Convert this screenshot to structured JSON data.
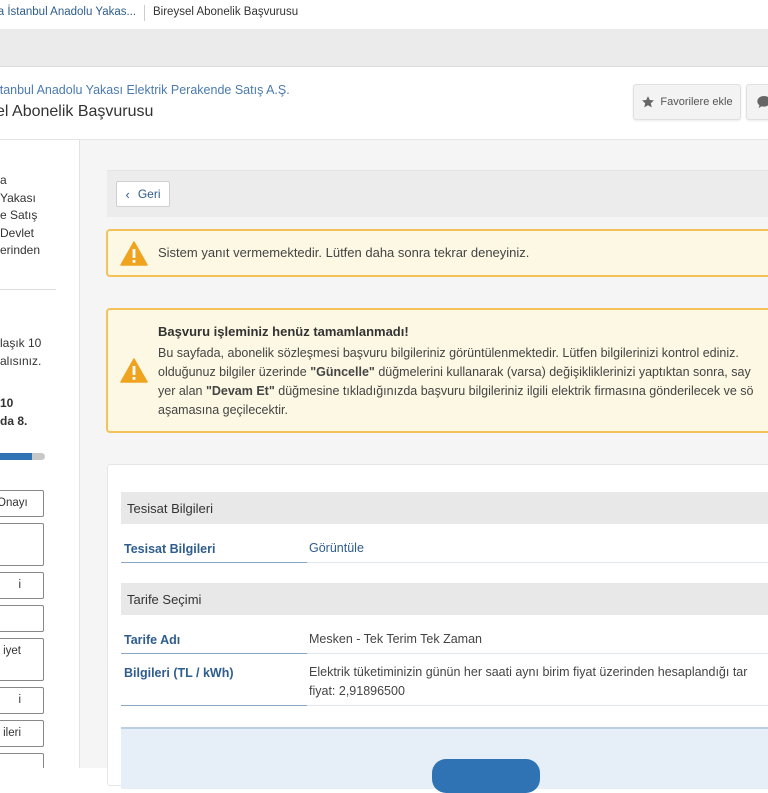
{
  "breadcrumb": {
    "company": "sa İstanbul Anadolu Yakas...",
    "current": "Bireysel Abonelik Başvurusu"
  },
  "header": {
    "org_name": "İstanbul Anadolu Yakası Elektrik Perakende Satış A.Ş.",
    "page_title": "sel Abonelik Başvurusu",
    "favorite_label": "Favorilere ekle"
  },
  "sidebar": {
    "description_lines": [
      "a",
      "Yakası",
      "e Satış",
      "Devlet",
      "erinden"
    ],
    "info_lines": [
      "laşık 10",
      "alısınız."
    ],
    "step_lines": [
      "10",
      "da 8."
    ],
    "progress_percent": 70,
    "steps": [
      "Onayı",
      "",
      "i",
      "",
      "iyet",
      "i",
      "ileri",
      ""
    ]
  },
  "main": {
    "back_label": "Geri",
    "alert_error": "Sistem yanıt vermemektedir. Lütfen daha sonra tekrar deneyiniz.",
    "alert_info": {
      "title": "Başvuru işleminiz henüz tamamlanmadı!",
      "line1": "Bu sayfada, abonelik sözleşmesi başvuru bilgileriniz görüntülenmektedir. Lütfen bilgilerinizi kontrol ediniz.",
      "line2_a": "olduğunuz bilgiler üzerinde ",
      "line2_b": "\"Güncelle\"",
      "line2_c": " düğmelerini kullanarak (varsa) değişikliklerinizi yaptıktan sonra, say",
      "line3_a": "yer alan ",
      "line3_b": "\"Devam Et\"",
      "line3_c": " düğmesine tıkladığınızda başvuru bilgileriniz ilgili elektrik firmasına gönderilecek ve sö",
      "line4": "aşamasına geçilecektir."
    },
    "sections": {
      "tesisat_header": "Tesisat Bilgileri",
      "tesisat_label": "Tesisat Bilgileri",
      "tesisat_value": "Görüntüle",
      "tarife_header": "Tarife Seçimi",
      "tarife_adi_label": "Tarife Adı",
      "tarife_adi_value": "Mesken - Tek Terim Tek Zaman",
      "bilgiler_label": "Bilgileri (TL / kWh)",
      "bilgiler_line1": "Elektrik tüketiminizin günün her saati aynı birim fiyat üzerinden hesaplandığı tar",
      "bilgiler_line2": "fiyat: 2,91896500"
    }
  },
  "colors": {
    "link": "#2e5d8e",
    "warning_border": "#f5c259",
    "warning_icon": "#f0a31e",
    "primary": "#2f73b5"
  }
}
